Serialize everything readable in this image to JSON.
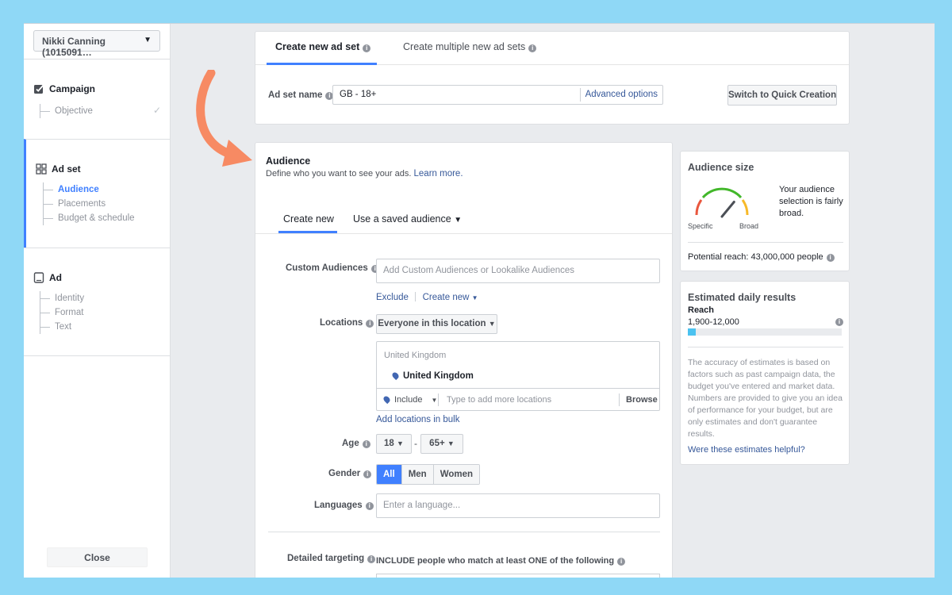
{
  "sidebar": {
    "account": "Nikki Canning (1015091…",
    "campaign": {
      "title": "Campaign",
      "items": [
        "Objective"
      ]
    },
    "adset": {
      "title": "Ad set",
      "items": [
        "Audience",
        "Placements",
        "Budget & schedule"
      ]
    },
    "ad": {
      "title": "Ad",
      "items": [
        "Identity",
        "Format",
        "Text"
      ]
    },
    "close": "Close"
  },
  "header": {
    "tabs": [
      "Create new ad set",
      "Create multiple new ad sets"
    ],
    "adset_name_label": "Ad set name",
    "adset_name_value": "GB - 18+",
    "advanced_options": "Advanced options",
    "quick_creation": "Switch to Quick Creation"
  },
  "audience": {
    "title": "Audience",
    "subtitle": "Define who you want to see your ads.",
    "learn_more": "Learn more.",
    "tabs": [
      "Create new",
      "Use a saved audience"
    ],
    "custom_label": "Custom Audiences",
    "custom_placeholder": "Add Custom Audiences or Lookalike Audiences",
    "exclude": "Exclude",
    "create_new": "Create new",
    "locations_label": "Locations",
    "locations_select": "Everyone in this location",
    "location_country": "United Kingdom",
    "location_selected": "United Kingdom",
    "include": "Include",
    "location_placeholder": "Type to add more locations",
    "browse": "Browse",
    "bulk": "Add locations in bulk",
    "age_label": "Age",
    "age_min": "18",
    "age_sep": "-",
    "age_max": "65+",
    "gender_label": "Gender",
    "genders": [
      "All",
      "Men",
      "Women"
    ],
    "languages_label": "Languages",
    "languages_placeholder": "Enter a language...",
    "detailed_label": "Detailed targeting",
    "detailed_text": "INCLUDE people who match at least ONE of the following"
  },
  "audience_size": {
    "title": "Audience size",
    "description": "Your audience selection is fairly broad.",
    "specific": "Specific",
    "broad": "Broad",
    "potential_reach": "Potential reach: 43,000,000 people",
    "gauge_level": 0.72
  },
  "estimates": {
    "title": "Estimated daily results",
    "reach_label": "Reach",
    "reach_range": "1,900-12,000",
    "reach_fill": 0.05,
    "note": "The accuracy of estimates is based on factors such as past campaign data, the budget you've entered and market data. Numbers are provided to give you an idea of performance for your budget, but are only estimates and don't guarantee results.",
    "helpful": "Were these estimates helpful?"
  },
  "colors": {
    "accent": "#4080ff",
    "arrow": "#f78a63",
    "frame": "#8fd8f6"
  }
}
